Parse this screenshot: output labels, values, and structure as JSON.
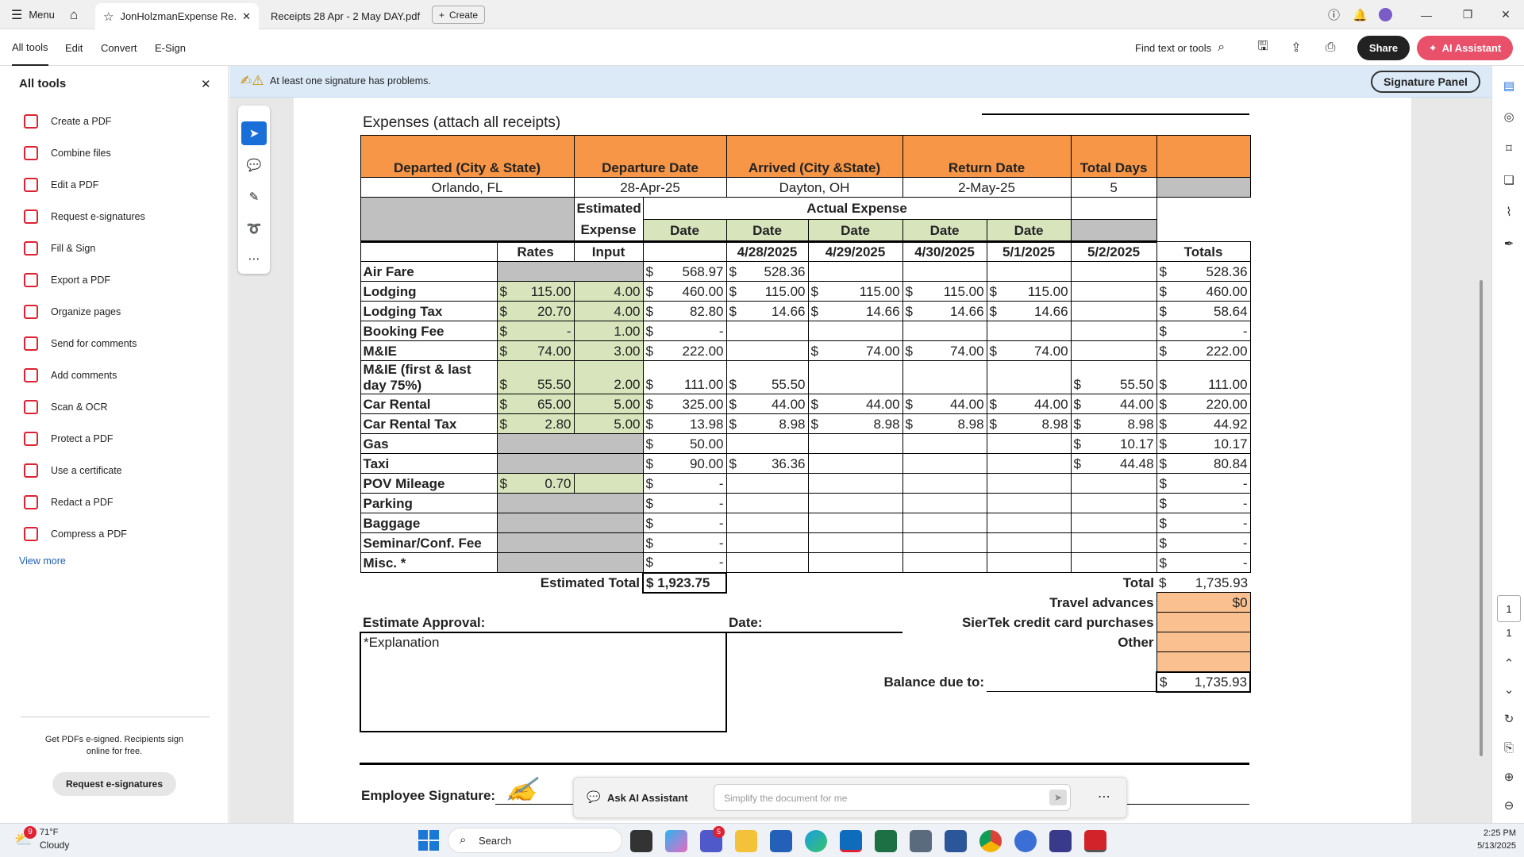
{
  "titlebar": {
    "menu_label": "Menu",
    "tabs": [
      {
        "label": "JonHolzmanExpense Re..."
      },
      {
        "label": "Receipts 28 Apr - 2 May DAY.pdf"
      }
    ],
    "create_label": "Create"
  },
  "menubar": {
    "items": [
      "All tools",
      "Edit",
      "Convert",
      "E-Sign"
    ],
    "find_label": "Find text or tools",
    "share_label": "Share",
    "ai_label": "AI Assistant"
  },
  "leftpanel": {
    "title": "All tools",
    "tools": [
      {
        "label": "Create a PDF",
        "icon": "create-pdf-icon"
      },
      {
        "label": "Combine files",
        "icon": "combine-files-icon"
      },
      {
        "label": "Edit a PDF",
        "icon": "edit-pdf-icon"
      },
      {
        "label": "Request e-signatures",
        "icon": "request-esign-icon"
      },
      {
        "label": "Fill & Sign",
        "icon": "fill-sign-icon"
      },
      {
        "label": "Export a PDF",
        "icon": "export-pdf-icon"
      },
      {
        "label": "Organize pages",
        "icon": "organize-pages-icon"
      },
      {
        "label": "Send for comments",
        "icon": "send-comments-icon"
      },
      {
        "label": "Add comments",
        "icon": "add-comments-icon"
      },
      {
        "label": "Scan & OCR",
        "icon": "scan-ocr-icon"
      },
      {
        "label": "Protect a PDF",
        "icon": "protect-pdf-icon"
      },
      {
        "label": "Use a certificate",
        "icon": "certificate-icon"
      },
      {
        "label": "Redact a PDF",
        "icon": "redact-pdf-icon"
      },
      {
        "label": "Compress a PDF",
        "icon": "compress-pdf-icon"
      }
    ],
    "view_more": "View more",
    "promo_text": "Get PDFs e-signed. Recipients sign online for free.",
    "promo_button": "Request e-signatures"
  },
  "signature_bar": {
    "message": "At least one signature has problems.",
    "panel_button": "Signature Panel"
  },
  "document": {
    "section_title": "Expenses  (attach all receipts)",
    "header": {
      "departed_label": "Departed (City & State)",
      "departure_date_label": "Departure Date",
      "arrived_label": "Arrived (City &State)",
      "return_date_label": "Return Date",
      "total_days_label": "Total Days",
      "departed": "Orlando, FL",
      "departure_date": "28-Apr-25",
      "arrived": "Dayton, OH",
      "return_date": "2-May-25",
      "total_days": "5"
    },
    "estimated_expense_label": "Estimated Expense",
    "actual_expense_label": "Actual Expense",
    "date_label": "Date",
    "rates_label": "Rates",
    "input_label": "Input",
    "totals_label": "Totals",
    "dates": [
      "4/28/2025",
      "4/29/2025",
      "4/30/2025",
      "5/1/2025",
      "5/2/2025"
    ],
    "currency": "$",
    "rows": [
      {
        "label": "Air Fare",
        "rate": "",
        "input": "",
        "est": "568.97",
        "d": [
          "528.36",
          "",
          "",
          "",
          ""
        ],
        "total": "528.36"
      },
      {
        "label": "Lodging",
        "rate": "115.00",
        "input": "4.00",
        "est": "460.00",
        "d": [
          "115.00",
          "115.00",
          "115.00",
          "115.00",
          ""
        ],
        "total": "460.00"
      },
      {
        "label": "Lodging Tax",
        "rate": "20.70",
        "input": "4.00",
        "est": "82.80",
        "d": [
          "14.66",
          "14.66",
          "14.66",
          "14.66",
          ""
        ],
        "total": "58.64"
      },
      {
        "label": "Booking Fee",
        "rate": "-",
        "input": "1.00",
        "est": "-",
        "d": [
          "",
          "",
          "",
          "",
          ""
        ],
        "total": "-"
      },
      {
        "label": "M&IE",
        "rate": "74.00",
        "input": "3.00",
        "est": "222.00",
        "d": [
          "",
          "74.00",
          "74.00",
          "74.00",
          ""
        ],
        "total": "222.00"
      },
      {
        "label": "M&IE (first & last day 75%)",
        "label_line1": "M&IE (first & last",
        "label_line2": "day 75%)",
        "rate": "55.50",
        "input": "2.00",
        "est": "111.00",
        "d": [
          "55.50",
          "",
          "",
          "",
          "55.50"
        ],
        "total": "111.00"
      },
      {
        "label": "Car Rental",
        "rate": "65.00",
        "input": "5.00",
        "est": "325.00",
        "d": [
          "44.00",
          "44.00",
          "44.00",
          "44.00",
          "44.00"
        ],
        "total": "220.00"
      },
      {
        "label": "Car Rental Tax",
        "rate": "2.80",
        "input": "5.00",
        "est": "13.98",
        "d": [
          "8.98",
          "8.98",
          "8.98",
          "8.98",
          "8.98"
        ],
        "total": "44.92"
      },
      {
        "label": "Gas",
        "rate": "",
        "input": "",
        "est": "50.00",
        "d": [
          "",
          "",
          "",
          "",
          "10.17"
        ],
        "total": "10.17"
      },
      {
        "label": "Taxi",
        "rate": "",
        "input": "",
        "est": "90.00",
        "d": [
          "36.36",
          "",
          "",
          "",
          "44.48"
        ],
        "total": "80.84"
      },
      {
        "label": "POV Mileage",
        "rate": "0.70",
        "input": "",
        "est": "-",
        "d": [
          "",
          "",
          "",
          "",
          ""
        ],
        "total": "-"
      },
      {
        "label": "Parking",
        "rate": "",
        "input": "",
        "est": "-",
        "d": [
          "",
          "",
          "",
          "",
          ""
        ],
        "total": "-"
      },
      {
        "label": "Baggage",
        "rate": "",
        "input": "",
        "est": "-",
        "d": [
          "",
          "",
          "",
          "",
          ""
        ],
        "total": "-"
      },
      {
        "label": "Seminar/Conf. Fee",
        "rate": "",
        "input": "",
        "est": "-",
        "d": [
          "",
          "",
          "",
          "",
          ""
        ],
        "total": "-"
      },
      {
        "label": "Misc. *",
        "rate": "",
        "input": "",
        "est": "-",
        "d": [
          "",
          "",
          "",
          "",
          ""
        ],
        "total": "-"
      }
    ],
    "estimated_total_label": "Estimated Total",
    "estimated_total": "$  1,923.75",
    "total_label": "Total",
    "total_value": "1,735.93",
    "travel_advances_label": "Travel advances",
    "travel_advances_value": "$0",
    "credit_card_label": "SierTek credit card purchases",
    "other_label": "Other",
    "estimate_approval_label": "Estimate Approval:",
    "date_field_label": "Date:",
    "explanation_label": "*Explanation",
    "balance_due_label": "Balance due to:",
    "balance_due_value": "1,735.93",
    "employee_signature_label": "Employee Signature:"
  },
  "ai_bar": {
    "label": "Ask AI Assistant",
    "placeholder": "Simplify the document for me"
  },
  "page_nav": {
    "current_page": "1",
    "total_pages": "1"
  },
  "taskbar": {
    "weather_temp": "71°F",
    "weather_desc": "Cloudy",
    "weather_badge": "9",
    "search_label": "Search",
    "teams_badge": "5",
    "time": "2:25 PM",
    "date": "5/13/2025"
  }
}
